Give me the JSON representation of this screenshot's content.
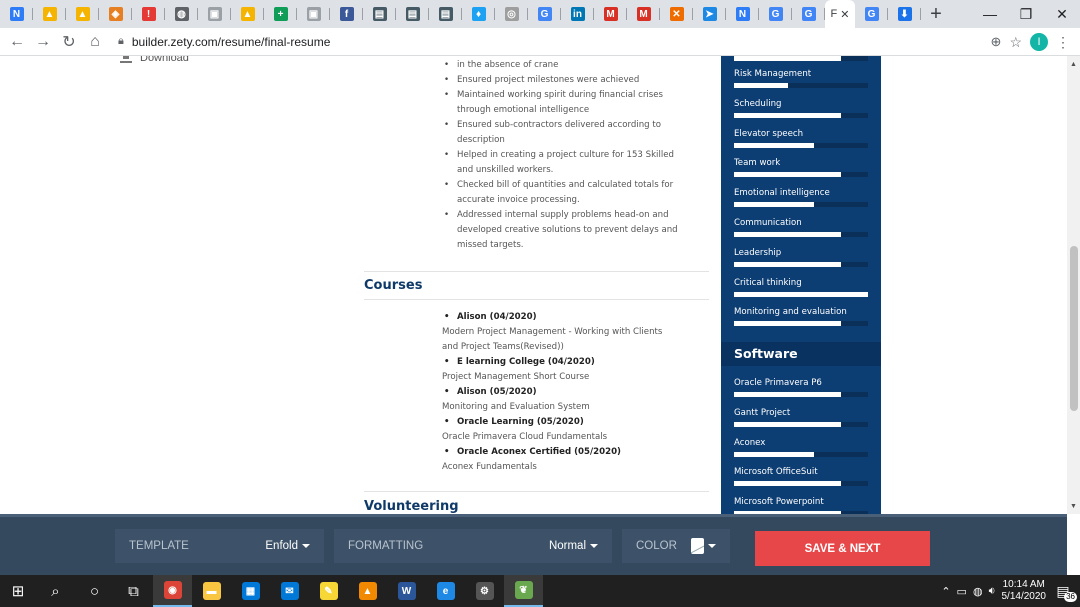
{
  "browser": {
    "tabs": [
      {
        "icon": "n-icon",
        "color": "#2e7cf6",
        "glyph": "N"
      },
      {
        "icon": "drive-icon",
        "color": "#f4b400",
        "glyph": "▲"
      },
      {
        "icon": "drive-icon",
        "color": "#f4b400",
        "glyph": "▲"
      },
      {
        "icon": "shield-icon",
        "color": "#e67e22",
        "glyph": "◈"
      },
      {
        "icon": "alert-icon",
        "color": "#e53935",
        "glyph": "!"
      },
      {
        "icon": "globe-icon",
        "color": "#5f6368",
        "glyph": "◍"
      },
      {
        "icon": "image-icon",
        "color": "#9aa0a6",
        "glyph": "▣"
      },
      {
        "icon": "drive-icon",
        "color": "#f4b400",
        "glyph": "▲"
      },
      {
        "icon": "sheets-icon",
        "color": "#0f9d58",
        "glyph": "+"
      },
      {
        "icon": "image-icon",
        "color": "#9aa0a6",
        "glyph": "▣"
      },
      {
        "icon": "facebook-icon",
        "color": "#3b5998",
        "glyph": "f"
      },
      {
        "icon": "web-icon",
        "color": "#455a64",
        "glyph": "▤"
      },
      {
        "icon": "web-icon",
        "color": "#455a64",
        "glyph": "▤"
      },
      {
        "icon": "web-icon",
        "color": "#455a64",
        "glyph": "▤"
      },
      {
        "icon": "twitter-icon",
        "color": "#1da1f2",
        "glyph": "♦"
      },
      {
        "icon": "instagram-icon",
        "color": "#9e9e9e",
        "glyph": "◎"
      },
      {
        "icon": "google-icon",
        "color": "#4285f4",
        "glyph": "G"
      },
      {
        "icon": "linkedin-icon",
        "color": "#0077b5",
        "glyph": "in"
      },
      {
        "icon": "gmail-icon",
        "color": "#d93025",
        "glyph": "M"
      },
      {
        "icon": "gmail-icon",
        "color": "#d93025",
        "glyph": "M"
      },
      {
        "icon": "x-icon",
        "color": "#ef6c00",
        "glyph": "✕"
      },
      {
        "icon": "bookmark-icon",
        "color": "#1e88e5",
        "glyph": "➤"
      },
      {
        "icon": "n-icon",
        "color": "#2e7cf6",
        "glyph": "N"
      },
      {
        "icon": "google-icon",
        "color": "#4285f4",
        "glyph": "G"
      },
      {
        "icon": "google-icon",
        "color": "#4285f4",
        "glyph": "G"
      }
    ],
    "active_tab": {
      "letter": "F",
      "close": "✕"
    },
    "after_tabs": [
      {
        "icon": "google-icon",
        "color": "#4285f4",
        "glyph": "G"
      },
      {
        "icon": "download-icon",
        "color": "#1a73e8",
        "glyph": "⬇"
      }
    ],
    "new_tab": "+",
    "url": "builder.zety.com/resume/final-resume",
    "profile_initial": "I",
    "window_controls": {
      "minimize": "—",
      "restore": "❐",
      "close": "✕"
    }
  },
  "page": {
    "download_label": "Download",
    "experience_bullets": [
      [
        "in the absence of crane"
      ],
      [
        "Ensured project milestones were achieved"
      ],
      [
        "Maintained working spirit during financial crises",
        "through emotional intelligence"
      ],
      [
        "Ensured sub-contractors delivered according to",
        "description"
      ],
      [
        "Helped in creating a project culture for 153 Skilled",
        "and unskilled workers."
      ],
      [
        "Checked bill of quantities and calculated totals for",
        "accurate invoice processing."
      ],
      [
        "Addressed internal supply problems head-on and",
        "developed creative solutions to prevent delays and",
        "missed targets."
      ]
    ],
    "courses_title": "Courses",
    "courses": [
      {
        "school": "Alison (04/2020)",
        "lines": [
          "Modern Project Management - Working with Clients",
          "and Project Teams(Revised))"
        ]
      },
      {
        "school": "E learning College (04/2020)",
        "lines": [
          "Project Management Short Course"
        ]
      },
      {
        "school": "Alison (05/2020)",
        "lines": [
          "Monitoring and Evaluation System"
        ]
      },
      {
        "school": "Oracle Learning (05/2020)",
        "lines": [
          "Oracle Primavera Cloud Fundamentals"
        ]
      },
      {
        "school": "Oracle Aconex Certified (05/2020)",
        "lines": [
          "Aconex Fundamentals"
        ]
      }
    ],
    "volunteering_title": "Volunteering",
    "skills": [
      {
        "label": "Risk Management",
        "level": 0.4
      },
      {
        "label": "Scheduling",
        "level": 0.8
      },
      {
        "label": "Elevator speech",
        "level": 0.6
      },
      {
        "label": "Team work",
        "level": 0.8
      },
      {
        "label": "Emotional intelligence",
        "level": 0.6
      },
      {
        "label": "Communication",
        "level": 0.8
      },
      {
        "label": "Leadership",
        "level": 0.8
      },
      {
        "label": "Critical thinking",
        "level": 1.0
      },
      {
        "label": "Monitoring and evaluation",
        "level": 0.8
      }
    ],
    "software_title": "Software",
    "software": [
      {
        "label": "Oracle Primavera P6",
        "level": 0.8
      },
      {
        "label": "Gantt Project",
        "level": 0.8
      },
      {
        "label": "Aconex",
        "level": 0.6
      },
      {
        "label": "Microsoft OfficeSuit",
        "level": 0.8
      },
      {
        "label": "Microsoft Powerpoint",
        "level": 0.8
      }
    ]
  },
  "editor": {
    "template_label": "TEMPLATE",
    "template_value": "Enfold",
    "formatting_label": "FORMATTING",
    "formatting_value": "Normal",
    "color_label": "COLOR",
    "save_label": "SAVE & NEXT"
  },
  "taskbar": {
    "apps": [
      {
        "icon": "chrome-icon",
        "color": "#db4437",
        "glyph": "◉",
        "active": true
      },
      {
        "icon": "file-explorer-icon",
        "color": "#f9c642",
        "glyph": "▬"
      },
      {
        "icon": "store-icon",
        "color": "#0078d7",
        "glyph": "▦"
      },
      {
        "icon": "mail-icon",
        "color": "#0078d7",
        "glyph": "✉"
      },
      {
        "icon": "sticky-notes-icon",
        "color": "#f7d736",
        "glyph": "✎"
      },
      {
        "icon": "vlc-icon",
        "color": "#f18a00",
        "glyph": "▲"
      },
      {
        "icon": "word-icon",
        "color": "#2b579a",
        "glyph": "W"
      },
      {
        "icon": "edge-icon",
        "color": "#1e88e5",
        "glyph": "e"
      },
      {
        "icon": "settings-icon",
        "color": "#555555",
        "glyph": "⚙"
      },
      {
        "icon": "app-icon",
        "color": "#6aa84f",
        "glyph": "❦",
        "active": true
      }
    ],
    "time": "10:14 AM",
    "date": "5/14/2020",
    "notification_count": "36"
  }
}
